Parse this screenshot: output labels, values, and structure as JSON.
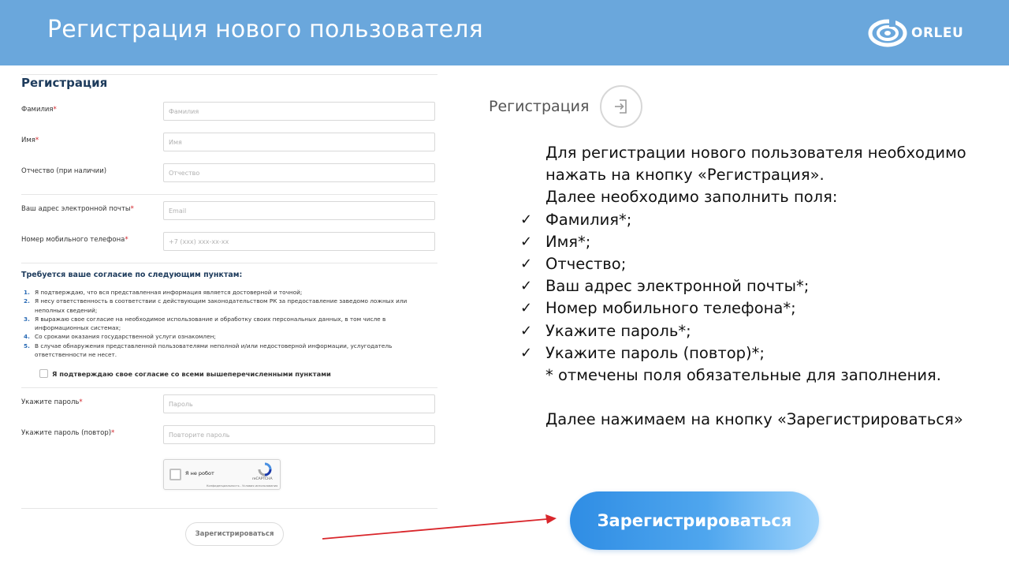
{
  "header": {
    "title": "Регистрация нового пользователя",
    "logo_text": "ORLEU",
    "logo_icon": "orleu-spiral-logo",
    "background_color": "#6aa7dc"
  },
  "form": {
    "title": "Регистрация",
    "fields": [
      {
        "label": "Фамилия",
        "required": "*",
        "placeholder": "Фамилия"
      },
      {
        "label": "Имя",
        "required": "*",
        "placeholder": "Имя"
      },
      {
        "label": "Отчество (при наличии)",
        "required": "",
        "placeholder": "Отчество"
      },
      {
        "label": "Ваш адрес электронной почты",
        "required": "*",
        "placeholder": "Email"
      },
      {
        "label": "Номер мобильного телефона",
        "required": "*",
        "placeholder": "+7 (xxx) xxx-xx-xx"
      }
    ],
    "consent": {
      "title": "Требуется ваше согласие по следующим пунктам:",
      "items": [
        {
          "num": "1.",
          "text": "Я подтверждаю, что вся представленная информация является достоверной и точной;"
        },
        {
          "num": "2.",
          "text": "Я несу ответственность в соответствии с действующим законодательством РК за предоставление заведомо ложных или неполных сведений;"
        },
        {
          "num": "3.",
          "text": "Я выражаю свое согласие на необходимое использование и обработку своих персональных данных, в том числе в информационных системах;"
        },
        {
          "num": "4.",
          "text": "Со сроками оказания государственной услуги ознакомлен;"
        },
        {
          "num": "5.",
          "text": "В случае обнаружения представленной пользователями неполной и/или недостоверной информации, услугодатель ответственности не несет."
        }
      ],
      "checkbox_label": "Я подтверждаю свое согласие со всеми вышеперечисленными пунктами"
    },
    "password_fields": [
      {
        "label": "Укажите пароль",
        "required": "*",
        "placeholder": "Пароль"
      },
      {
        "label": "Укажите пароль (повтор)",
        "required": "*",
        "placeholder": "Повторите пароль"
      }
    ],
    "captcha": {
      "label": "Я не робот",
      "brand": "reCAPTCHA",
      "links": "Конфиденциальность - Условия использования"
    },
    "submit_label": "Зарегистрироваться"
  },
  "right": {
    "register_link_label": "Регистрация",
    "register_icon": "sign-in-icon",
    "intro_lines": [
      "Для регистрации нового пользователя необходимо",
      "нажать на кнопку «Регистрация».",
      "Далее необходимо заполнить поля:"
    ],
    "checked_items": [
      "Фамилия*;",
      "Имя*;",
      "Отчество;",
      "Ваш адрес электронной почты*;",
      "Номер мобильного телефона*;",
      "Укажите пароль*;",
      "Укажите пароль (повтор)*;"
    ],
    "note": "* отмечены поля обязательные для заполнения.",
    "final_line": "Далее нажимаем на кнопку «Зарегистрироваться»",
    "check_glyph": "✓",
    "big_button_label": "Зарегистрироваться",
    "arrow_color": "#d9262b"
  }
}
